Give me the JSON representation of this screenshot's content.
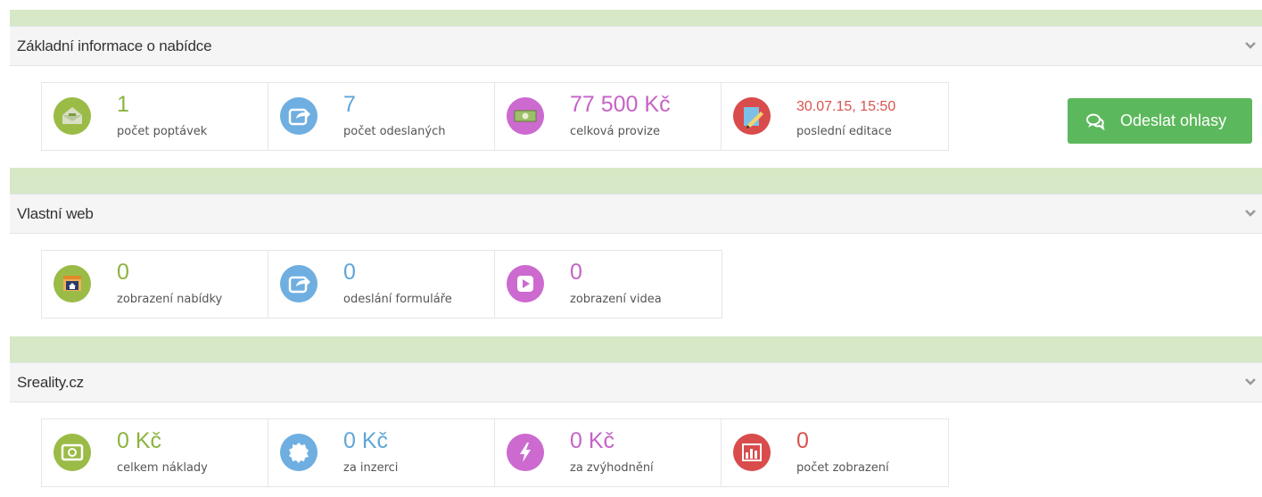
{
  "panels": [
    {
      "title": "Základní informace o nabídce",
      "stats": [
        {
          "value": "1",
          "label": "počet poptávek",
          "icon": "inbox-icon",
          "color": "#8cb43f"
        },
        {
          "value": "7",
          "label": "počet odeslaných",
          "icon": "share-icon",
          "color": "#5fa6d8"
        },
        {
          "value": "77 500 Kč",
          "label": "celková provize",
          "icon": "money-icon",
          "color": "#c563c7"
        },
        {
          "value": "30.07.15, 15:50",
          "label": "poslední editace",
          "icon": "edit-icon",
          "color": "#d9534f"
        }
      ],
      "button": {
        "label": "Odeslat ohlasy",
        "icon": "chat-icon",
        "color": "#5cb85c"
      }
    },
    {
      "title": "Vlastní web",
      "stats": [
        {
          "value": "0",
          "label": "zobrazení nabídky",
          "icon": "home-window-icon",
          "color": "#8cb43f"
        },
        {
          "value": "0",
          "label": "odeslání formuláře",
          "icon": "share-icon",
          "color": "#5fa6d8"
        },
        {
          "value": "0",
          "label": "zobrazení videa",
          "icon": "play-icon",
          "color": "#c563c7"
        }
      ]
    },
    {
      "title": "Sreality.cz",
      "stats": [
        {
          "value": "0 Kč",
          "label": "celkem náklady",
          "icon": "banknote-icon",
          "color": "#8cb43f"
        },
        {
          "value": "0 Kč",
          "label": "za inzerci",
          "icon": "badge-icon",
          "color": "#5fa6d8"
        },
        {
          "value": "0 Kč",
          "label": "za zvýhodnění",
          "icon": "lightning-icon",
          "color": "#c563c7"
        },
        {
          "value": "0",
          "label": "počet zobrazení",
          "icon": "bar-chart-icon",
          "color": "#d9534f"
        }
      ]
    }
  ],
  "colors": {
    "header_strip": "#d6e8c6",
    "panel_header": "#f5f5f5"
  }
}
